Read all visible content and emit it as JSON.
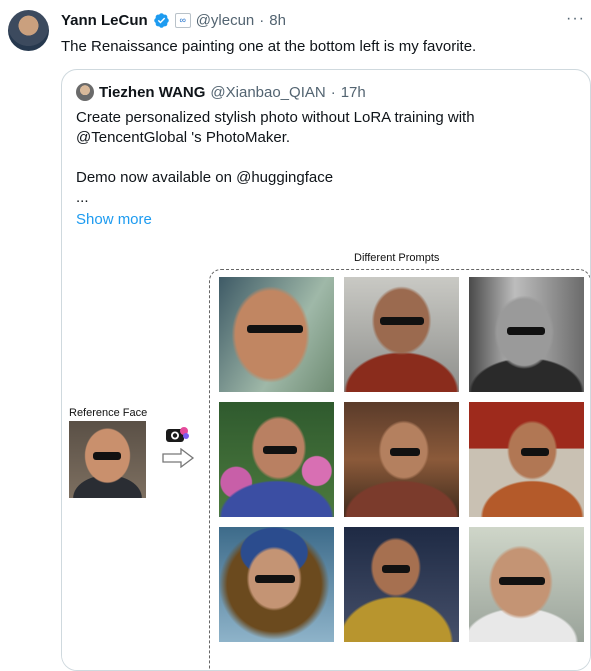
{
  "tweet": {
    "author_name": "Yann LeCun",
    "author_handle": "@ylecun",
    "separator": "·",
    "time": "8h",
    "more": "···",
    "text": "The Renaissance painting one at the bottom left is my favorite."
  },
  "quote": {
    "author_name": "Tiezhen WANG",
    "author_handle": "@Xianbao_QIAN",
    "separator": "·",
    "time": "17h",
    "lines": [
      "Create personalized stylish photo without LoRA training with",
      "@TencentGlobal 's PhotoMaker.",
      "",
      "Demo now available on @huggingface",
      "..."
    ],
    "show_more": "Show more",
    "figure": {
      "title": "Different Prompts",
      "reference_label": "Reference Face"
    }
  },
  "colors": {
    "accent": "#1d9bf0",
    "muted": "#536471",
    "border": "#cfd9de"
  },
  "icons": [
    "verified-badge-icon",
    "meta-affiliation-icon",
    "more-icon",
    "photomaker-logo-icon",
    "arrow-right-icon"
  ]
}
